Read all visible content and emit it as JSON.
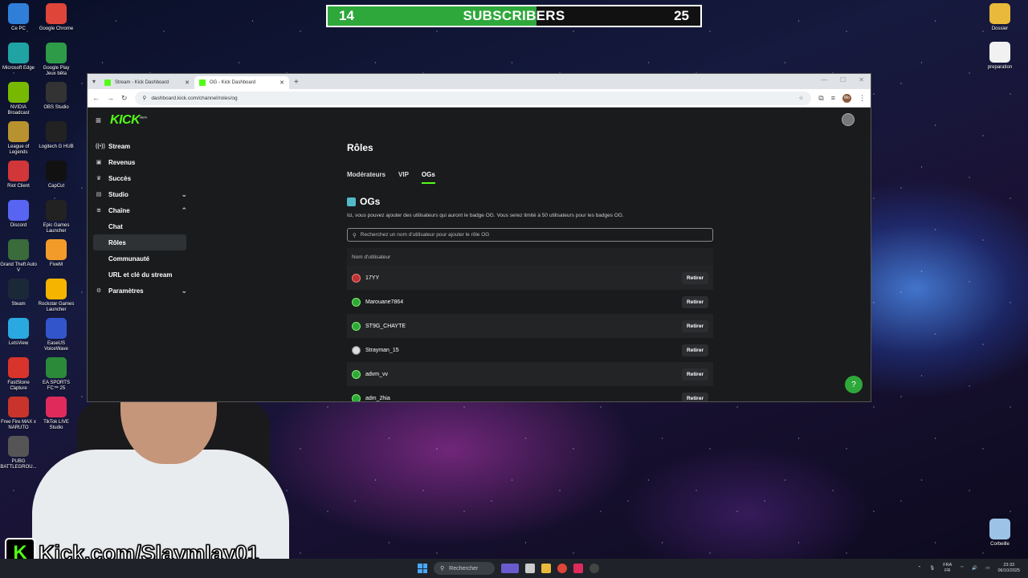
{
  "subscribers": {
    "current": "14",
    "label": "SUBSCRIBERS",
    "goal": "25",
    "progress": 0.56
  },
  "desktop_left": [
    {
      "label": "Ce PC",
      "icon": "pc-icon",
      "color": "#2f7fd9"
    },
    {
      "label": "Google Chrome",
      "icon": "chrome-icon",
      "color": "#e0453a"
    },
    {
      "label": "Microsoft Edge",
      "icon": "edge-icon",
      "color": "#1fa3a3"
    },
    {
      "label": "Google Play Jeux bêta",
      "icon": "google-play-games-icon",
      "color": "#2e9b48"
    },
    {
      "label": "NVIDIA Broadcast",
      "icon": "nvidia-icon",
      "color": "#76b900"
    },
    {
      "label": "OBS Studio",
      "icon": "obs-icon",
      "color": "#333333"
    },
    {
      "label": "League of Legends",
      "icon": "lol-icon",
      "color": "#b8922f"
    },
    {
      "label": "Logitech G HUB",
      "icon": "logitech-icon",
      "color": "#222222"
    },
    {
      "label": "Riot Client",
      "icon": "riot-icon",
      "color": "#d13639"
    },
    {
      "label": "CapCut",
      "icon": "capcut-icon",
      "color": "#111111"
    },
    {
      "label": "Discord",
      "icon": "discord-icon",
      "color": "#5865f2"
    },
    {
      "label": "Epic Games Launcher",
      "icon": "epic-icon",
      "color": "#222222"
    },
    {
      "label": "Grand Theft Auto V",
      "icon": "gta-icon",
      "color": "#3a6b3a"
    },
    {
      "label": "FiveM",
      "icon": "fivem-icon",
      "color": "#f39b2a"
    },
    {
      "label": "Steam",
      "icon": "steam-icon",
      "color": "#1b2838"
    },
    {
      "label": "Rockstar Games Launcher",
      "icon": "rockstar-icon",
      "color": "#f5b400"
    },
    {
      "label": "LetsView",
      "icon": "letsview-icon",
      "color": "#2aa9e0"
    },
    {
      "label": "EaseUS VoiceWave",
      "icon": "easeus-icon",
      "color": "#3355cc"
    },
    {
      "label": "FastStone Capture",
      "icon": "faststone-icon",
      "color": "#d8342c"
    },
    {
      "label": "EA SPORTS FC™ 25",
      "icon": "fc25-icon",
      "color": "#2a8a3a"
    },
    {
      "label": "Free Fire MAX x NARUTO",
      "icon": "freefire-icon",
      "color": "#c8342c"
    },
    {
      "label": "TikTok LIVE Studio",
      "icon": "tiktok-icon",
      "color": "#e02a5c"
    },
    {
      "label": "PUBG BATTLEGROU...",
      "icon": "pubg-icon",
      "color": "#555555"
    }
  ],
  "desktop_right": [
    {
      "label": "Dossier",
      "icon": "folder-icon",
      "color": "#e8b93a"
    },
    {
      "label": "preparation",
      "icon": "document-icon",
      "color": "#f1f1f1"
    },
    {
      "label": "Corbeille",
      "icon": "recycle-bin-icon",
      "color": "#9cc3e6"
    }
  ],
  "browser": {
    "tabs": [
      {
        "title": "Stream - Kick Dashboard",
        "active": false
      },
      {
        "title": "OG - Kick Dashboard",
        "active": true
      }
    ],
    "url": "dashboard.kick.com/channel/roles/og",
    "profile": "Mo"
  },
  "kick": {
    "logo": "KICK",
    "logo_tag": "BETA",
    "sidebar": [
      {
        "label": "Stream",
        "icon": "stream-icon",
        "kind": "top"
      },
      {
        "label": "Revenus",
        "icon": "revenue-icon",
        "kind": "top"
      },
      {
        "label": "Succès",
        "icon": "trophy-icon",
        "kind": "top"
      },
      {
        "label": "Studio",
        "icon": "studio-icon",
        "kind": "top",
        "chevron": "⌄"
      },
      {
        "label": "Chaîne",
        "icon": "channel-icon",
        "kind": "top",
        "chevron": "⌃"
      },
      {
        "label": "Chat",
        "kind": "sub"
      },
      {
        "label": "Rôles",
        "kind": "sub",
        "selected": true
      },
      {
        "label": "Communauté",
        "kind": "sub"
      },
      {
        "label": "URL et clé du stream",
        "kind": "sub"
      },
      {
        "label": "Paramètres",
        "icon": "gear-icon",
        "kind": "top",
        "chevron": "⌄"
      }
    ],
    "page_title": "Rôles",
    "tabs": [
      {
        "label": "Modérateurs",
        "active": false
      },
      {
        "label": "VIP",
        "active": false
      },
      {
        "label": "OGs",
        "active": true
      }
    ],
    "section_title": "OGs",
    "description": "Ici, vous pouvez ajouter des utilisateurs qui auront le badge OG. Vous serez limité à 50 utilisateurs pour les badges OG.",
    "search_placeholder": "Recherchez un nom d'utilisateur pour ajouter le rôle OG",
    "column_header": "Nom d'utilisateur",
    "remove_label": "Retirer",
    "users": [
      {
        "name": "17YY",
        "badge": "r"
      },
      {
        "name": "Marouane7864",
        "badge": "g"
      },
      {
        "name": "ST9G_CHAYTE",
        "badge": "g"
      },
      {
        "name": "Strayman_15",
        "badge": "w"
      },
      {
        "name": "advm_vv",
        "badge": "g"
      },
      {
        "name": "adm_2hia",
        "badge": "g"
      }
    ]
  },
  "overlay_text": "Kick.com/Slaymlay01",
  "taskbar": {
    "search": "Rechercher",
    "lang": "FRA",
    "region": "FR",
    "time": "23:33",
    "date": "06/10/2025"
  }
}
